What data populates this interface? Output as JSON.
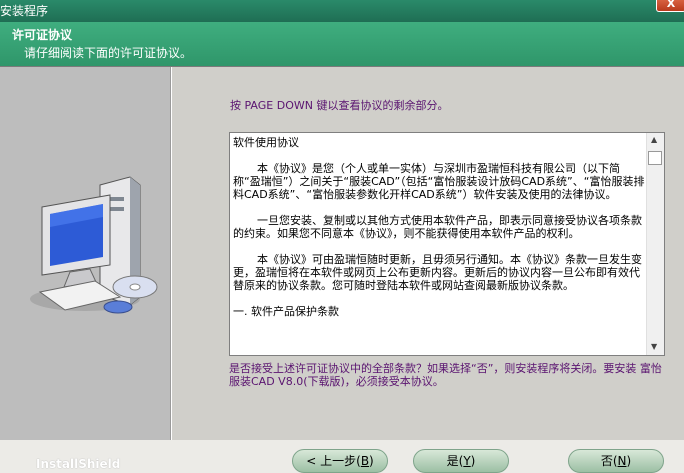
{
  "window": {
    "title": "安装程序",
    "close_label": "X"
  },
  "header": {
    "title": "许可证协议",
    "subtitle": "请仔细阅读下面的许可证协议。"
  },
  "instruction": "按 PAGE DOWN 键以查看协议的剩余部分。",
  "license": {
    "paragraphs": [
      "软件使用协议",
      "本《协议》是您（个人或单一实体）与深圳市盈瑞恒科技有限公司（以下简称“盈瑞恒”）之间关于“服装CAD”（包括“富怡服装设计放码CAD系统”、“富怡服装排料CAD系统”、“富怡服装参数化开样CAD系统”）软件安装及使用的法律协议。",
      "一旦您安装、复制或以其他方式使用本软件产品，即表示同意接受协议各项条款的约束。如果您不同意本《协议》，则不能获得使用本软件产品的权利。",
      "本《协议》可由盈瑞恒随时更新，且毋须另行通知。本《协议》条款一旦发生变更，盈瑞恒将在本软件或网页上公布更新内容。更新后的协议内容一旦公布即有效代替原来的协议条款。您可随时登陆本软件或网站查阅最新版协议条款。",
      "一. 软件产品保护条款"
    ]
  },
  "question": "是否接受上述许可证协议中的全部条款？如果选择“否”，则安装程序将关闭。要安装 富怡服装CAD V8.0(下载版)，必须接受本协议。",
  "footer": {
    "brand": "InstallShield",
    "back_label": "< 上一步",
    "back_key": "B",
    "yes_label": "是",
    "yes_key": "Y",
    "no_label": "否",
    "no_key": "N"
  }
}
